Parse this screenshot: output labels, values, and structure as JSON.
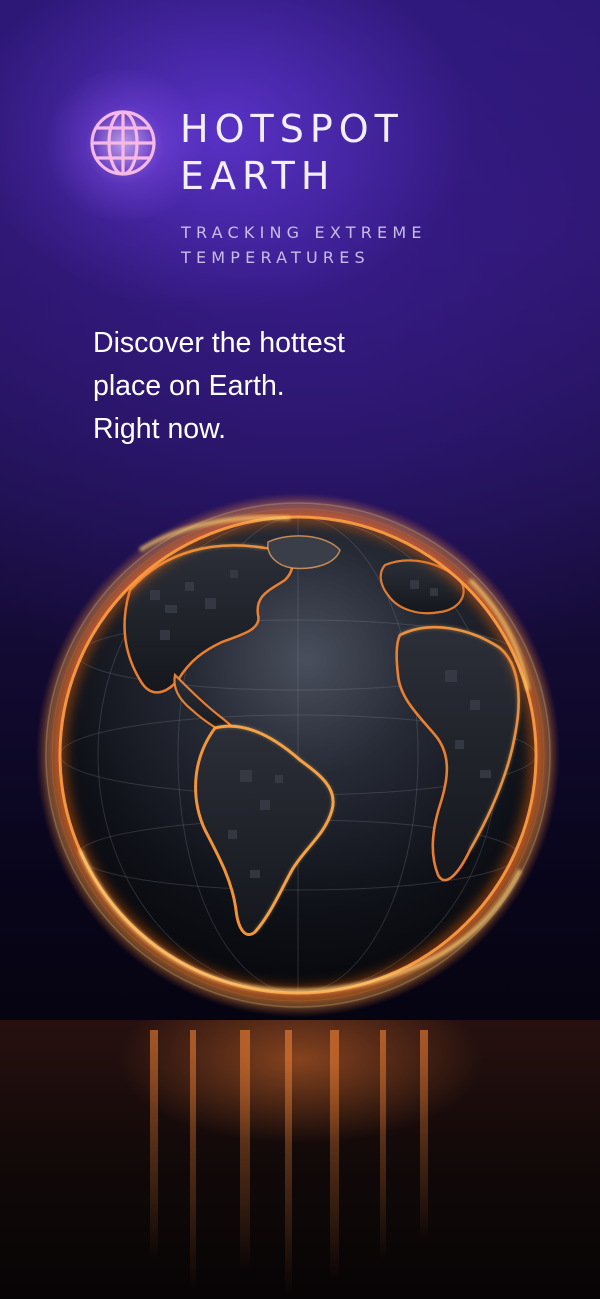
{
  "brand": {
    "title_line1": "HOTSPOT",
    "title_line2": "EARTH",
    "tagline_line1": "TRACKING EXTREME",
    "tagline_line2": "TEMPERATURES",
    "logo_icon": "globe-icon"
  },
  "hero": {
    "line1": "Discover the hottest",
    "line2": "place on Earth.",
    "line3": "Right now."
  },
  "illustration": {
    "subject": "glowing-earth-globe",
    "colors": {
      "background_top": "#2a1772",
      "background_bottom": "#07040f",
      "glow": "#ff7a2a",
      "hot": "#ffcf6a"
    }
  }
}
